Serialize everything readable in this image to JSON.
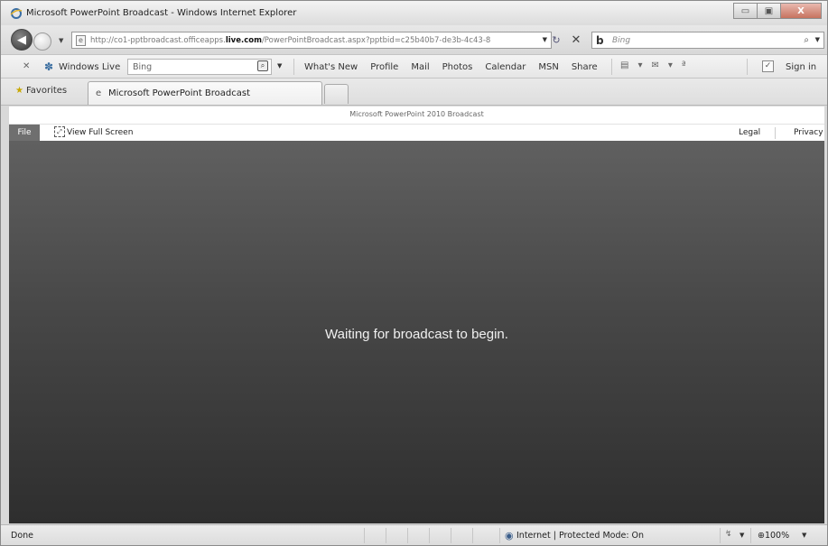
{
  "window": {
    "title": "Microsoft PowerPoint Broadcast - Windows Internet Explorer",
    "minimize_glyph": "▭",
    "maximize_glyph": "▣",
    "close_glyph": "X"
  },
  "address": {
    "url_prefix": "http://co1-pptbroadcast.officeapps.",
    "url_domain": "live.com",
    "url_suffix": "/PowerPointBroadcast.aspx?pptbid=c25b40b7-de3b-4c43-8",
    "search_placeholder": "Bing"
  },
  "wl_toolbar": {
    "brand": "Windows Live",
    "search_value": "Bing",
    "links": [
      "What's New",
      "Profile",
      "Mail",
      "Photos",
      "Calendar",
      "MSN",
      "Share"
    ],
    "sign_in": "Sign in"
  },
  "favorites": {
    "label": "Favorites",
    "active_tab": "Microsoft PowerPoint Broadcast"
  },
  "page": {
    "header_title": "Microsoft PowerPoint 2010 Broadcast",
    "file_button": "File",
    "full_screen": "View Full Screen",
    "legal": "Legal",
    "privacy": "Privacy",
    "message": "Waiting for broadcast to begin."
  },
  "status": {
    "text": "Done",
    "zone": "Internet | Protected Mode: On",
    "zoom": "100%"
  },
  "icons": {
    "ie": "ie-icon",
    "back": "back-arrow-icon",
    "forward": "forward-arrow-icon",
    "refresh": "refresh-icon",
    "stop": "stop-icon",
    "bing": "bing-logo-icon",
    "search": "magnifier-icon",
    "favorites": "star-icon",
    "fullscreen": "fullscreen-icon",
    "globe": "globe-icon",
    "zoom": "zoom-icon"
  }
}
